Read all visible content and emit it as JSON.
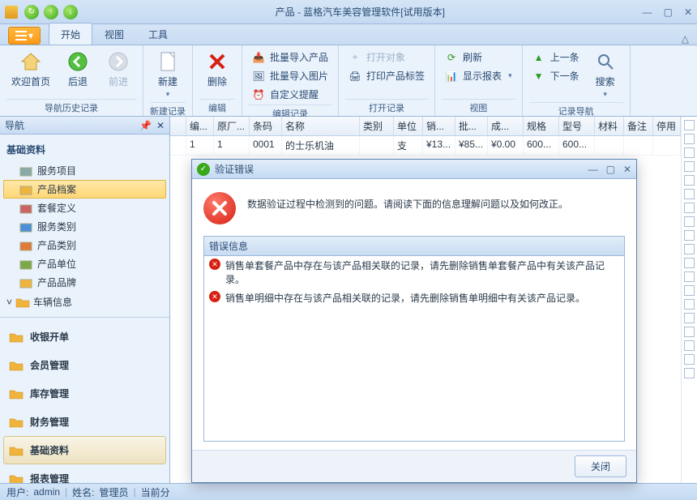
{
  "window": {
    "title": "产品 - 蓝格汽车美容管理软件[试用版本]"
  },
  "ribbon_tabs": [
    "开始",
    "视图",
    "工具"
  ],
  "ribbon": {
    "groups": {
      "history": {
        "label": "导航历史记录",
        "home": "欢迎首页",
        "back": "后退",
        "forward": "前进"
      },
      "newrec": {
        "label": "新建记录",
        "new": "新建"
      },
      "edit": {
        "label": "编辑",
        "delete": "删除"
      },
      "editrec": {
        "label": "编辑记录",
        "batch_import_product": "批量导入产品",
        "batch_import_image": "批量导入图片",
        "custom_reminder": "自定义提醒"
      },
      "openrec": {
        "label": "打开记录",
        "open_object": "打开对象",
        "print_tag": "打印产品标签"
      },
      "view": {
        "label": "视图",
        "refresh": "刷新",
        "show_report": "显示报表"
      },
      "recordnav": {
        "label": "记录导航",
        "prev": "上一条",
        "next": "下一条",
        "search": "搜索"
      }
    }
  },
  "sidebar": {
    "title": "导航",
    "tree_section": "基础资料",
    "tree_items": [
      "服务项目",
      "产品档案",
      "套餐定义",
      "服务类别",
      "产品类别",
      "产品单位",
      "产品品牌"
    ],
    "tree_selected": "产品档案",
    "tree_expand": "车辆信息",
    "categories": [
      "收银开单",
      "会员管理",
      "库存管理",
      "财务管理",
      "基础资料",
      "报表管理"
    ],
    "category_active": "基础资料"
  },
  "grid": {
    "columns": [
      "",
      "编...",
      "原厂...",
      "条码",
      "名称",
      "类别",
      "单位",
      "销...",
      "批...",
      "成...",
      "规格",
      "型号",
      "材料",
      "备注",
      "停用"
    ],
    "rows": [
      {
        "cells": [
          "",
          "1",
          "1",
          "0001",
          "的士乐机油",
          "",
          "支",
          "¥13...",
          "¥85...",
          "¥0.00",
          "600...",
          "600...",
          "",
          "",
          ""
        ]
      }
    ]
  },
  "dialog": {
    "title": "验证错误",
    "message": "数据验证过程中检测到的问题。请阅读下面的信息理解问题以及如何改正。",
    "panel_title": "错误信息",
    "errors": [
      "销售单套餐产品中存在与该产品相关联的记录，请先删除销售单套餐产品中有关该产品记录。",
      "销售单明细中存在与该产品相关联的记录，请先删除销售单明细中有关该产品记录。"
    ],
    "close": "关闭"
  },
  "status": {
    "user_label": "用户: ",
    "user": "admin",
    "name_label": "姓名: ",
    "name": "管理员",
    "extra": "当前分"
  }
}
